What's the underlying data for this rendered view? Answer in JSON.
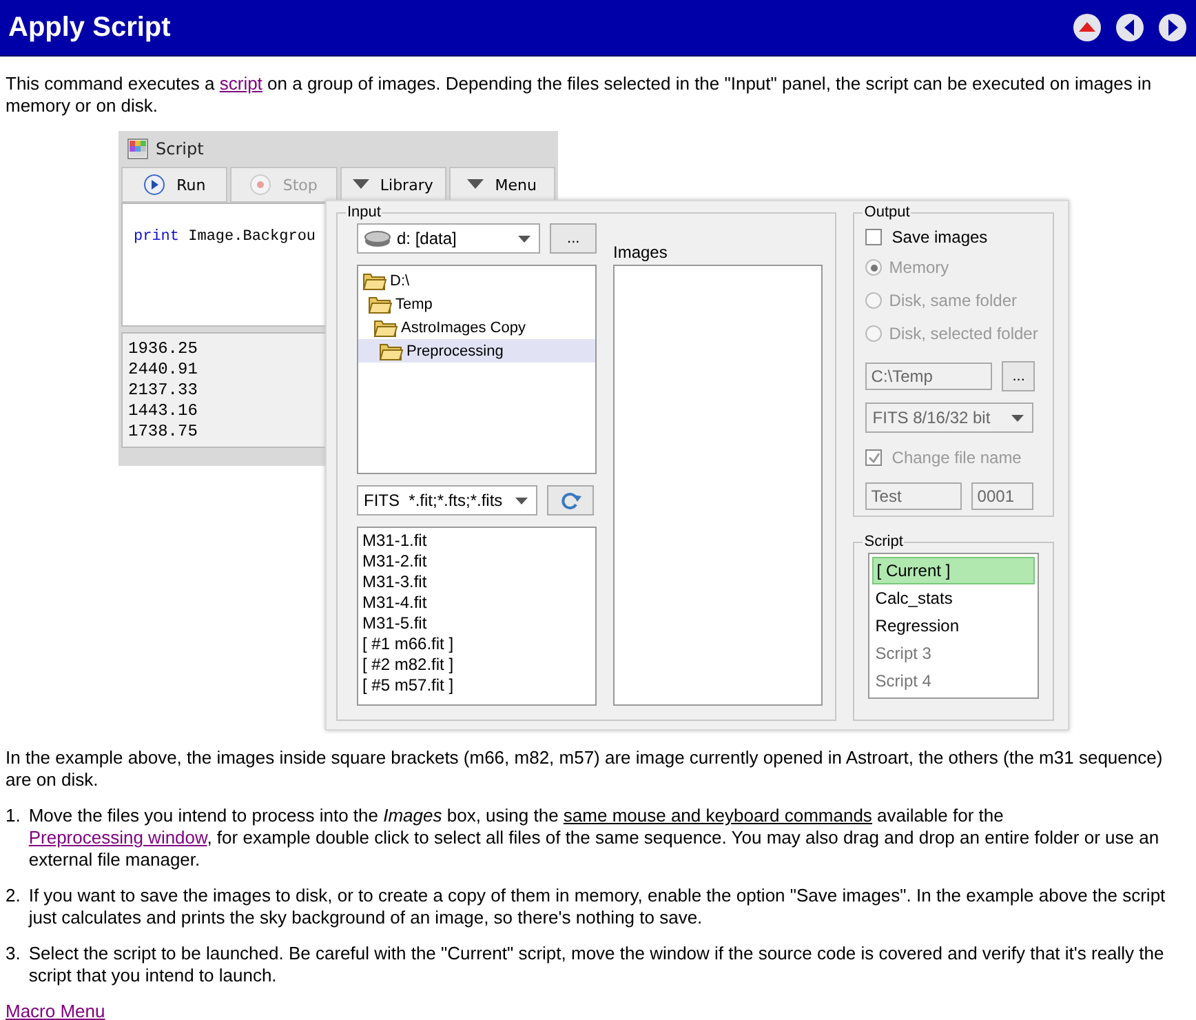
{
  "header": {
    "title": "Apply Script"
  },
  "intro": [
    {
      "kind": "text",
      "text": "This command executes a "
    },
    {
      "kind": "link",
      "text": "script"
    },
    {
      "kind": "text",
      "text": " on a group of images. Depending the files selected in the \"Input\" panel, the script can be executed on images in memory or on disk."
    }
  ],
  "script_window": {
    "title": "Script",
    "toolbar": [
      {
        "label": "Run",
        "kind": "run",
        "disabled": false
      },
      {
        "label": "Stop",
        "kind": "stop",
        "disabled": true
      },
      {
        "label": "Library",
        "kind": "menu",
        "disabled": false
      },
      {
        "label": "Menu",
        "kind": "menu",
        "disabled": false
      }
    ],
    "code": {
      "keyword": "print",
      "text": "Image.Backgrou"
    },
    "output": [
      "1936.25",
      "2440.91",
      "2137.33",
      "1443.16",
      "1738.75"
    ]
  },
  "apply_dialog": {
    "input": {
      "legend": "Input",
      "drive": "d: [data]",
      "browse": "...",
      "folders": [
        {
          "label": "D:\\",
          "selected": false,
          "children": [
            {
              "label": "Temp",
              "selected": false,
              "children": [
                {
                  "label": "AstroImages Copy",
                  "selected": false,
                  "children": [
                    {
                      "label": "Preprocessing",
                      "selected": true
                    }
                  ]
                }
              ]
            }
          ]
        }
      ],
      "filter": "FITS  *.fit;*.fts;*.fits",
      "files": [
        "M31-1.fit",
        "M31-2.fit",
        "M31-3.fit",
        "M31-4.fit",
        "M31-5.fit",
        "[ #1 m66.fit ]",
        "[ #2 m82.fit ]",
        "[ #5 m57.fit ]"
      ]
    },
    "images": {
      "label": "Images"
    },
    "output": {
      "legend": "Output",
      "save_images": {
        "label": "Save images",
        "checked": false
      },
      "destinations": [
        {
          "label": "Memory",
          "selected": true,
          "disabled": true
        },
        {
          "label": "Disk, same folder",
          "selected": false,
          "disabled": true
        },
        {
          "label": "Disk, selected folder",
          "selected": false,
          "disabled": true
        }
      ],
      "folder": "C:\\Temp",
      "browse": "...",
      "format": "FITS 8/16/32 bit",
      "change_name": {
        "label": "Change file name",
        "checked": true,
        "disabled": true
      },
      "prefix": "Test",
      "number": "0001"
    },
    "script": {
      "legend": "Script",
      "items": [
        {
          "label": "[ Current ]",
          "selected": true,
          "disabled": false
        },
        {
          "label": "Calc_stats",
          "selected": false,
          "disabled": false
        },
        {
          "label": "Regression",
          "selected": false,
          "disabled": false
        },
        {
          "label": "Script 3",
          "selected": false,
          "disabled": true
        },
        {
          "label": "Script 4",
          "selected": false,
          "disabled": true
        }
      ]
    }
  },
  "example_note": "In the example above, the images inside square brackets (m66, m82, m57) are image currently opened in Astroart, the others (the m31 sequence) are on disk.",
  "steps": [
    {
      "number": "1.",
      "segments": [
        {
          "kind": "text",
          "text": "Move the files you intend to process into the *Images* box, using the "
        },
        {
          "kind": "underline",
          "text": "same mouse and keyboard commands"
        },
        {
          "kind": "text",
          "text": " available for the "
        },
        {
          "kind": "link",
          "text": "Preprocessing window"
        },
        {
          "kind": "text",
          "text": ", for example double click to select all files of the same sequence. You may also drag and drop an entire folder or use an external file manager."
        }
      ]
    },
    {
      "number": "2.",
      "segments": [
        {
          "kind": "text",
          "text": "If you want to save the images to disk, or to create a copy of them in memory, enable the option \"Save images\". In the example above the script just calculates and prints the sky background of an image, so there's nothing to save."
        }
      ]
    },
    {
      "number": "3.",
      "segments": [
        {
          "kind": "text",
          "text": "Select the script to be launched. Be careful with the \"Current\" script, move the window if the source code is covered and verify that it's really the script that you intend to launch."
        }
      ]
    }
  ],
  "footer_link": "Macro Menu"
}
